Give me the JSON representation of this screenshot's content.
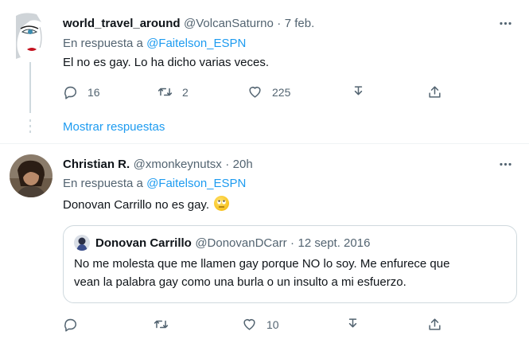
{
  "tweet1": {
    "display_name": "world_travel_around",
    "handle": "@VolcanSaturno",
    "separator": "·",
    "time": "7 feb.",
    "reply_prefix": "En respuesta a",
    "reply_to": "@Faitelson_ESPN",
    "text": "El no es gay. Lo ha dicho varias veces.",
    "replies": "16",
    "retweets": "2",
    "likes": "225"
  },
  "show_replies": "Mostrar respuestas",
  "tweet2": {
    "display_name": "Christian R.",
    "handle": "@xmonkeynutsx",
    "separator": "·",
    "time": "20h",
    "reply_prefix": "En respuesta a",
    "reply_to": "@Faitelson_ESPN",
    "text": "Donovan Carrillo no es gay.",
    "emoji": "face-with-rolling-eyes",
    "likes": "10",
    "quote": {
      "display_name": "Donovan Carrillo",
      "handle": "@DonovanDCarr",
      "separator": "·",
      "time": "12 sept. 2016",
      "text_line1": "No me molesta que me llamen gay porque NO lo soy. Me enfurece que",
      "text_line2": "vean la palabra gay como una burla o un insulto a mi esfuerzo."
    }
  },
  "colors": {
    "accent": "#1d9bf0",
    "secondary_text": "#536471",
    "primary_text": "#0f1419",
    "border": "#cfd9de",
    "thread_line": "#cfd9de"
  }
}
